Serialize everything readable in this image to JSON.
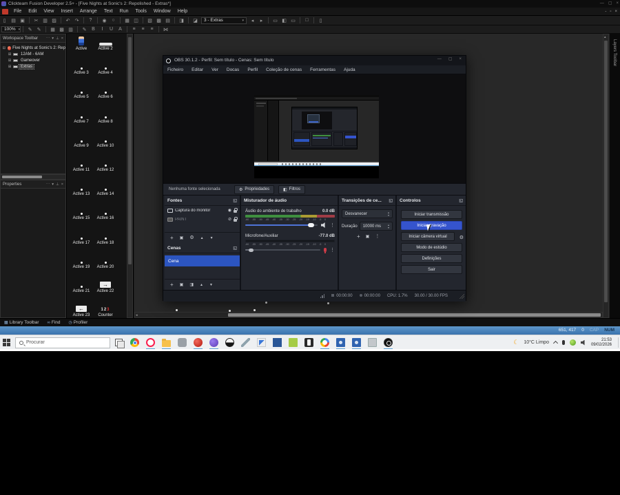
{
  "fusion": {
    "title": "Clickteam Fusion Developer 2.5+ - [Five Nights at Sonic's 2: Repolished - Extras*]",
    "window_buttons": [
      {
        "name": "minimize-button",
        "glyph": "—"
      },
      {
        "name": "maximize-button",
        "glyph": "▢"
      },
      {
        "name": "close-button",
        "glyph": "×"
      }
    ],
    "menus": [
      "File",
      "Edit",
      "View",
      "Insert",
      "Arrange",
      "Text",
      "Run",
      "Tools",
      "Window",
      "Help"
    ],
    "toolbar1a": [
      {
        "name": "new-file-icon",
        "glyph": "▯"
      },
      {
        "name": "open-file-icon",
        "glyph": "▤"
      },
      {
        "name": "save-icon",
        "glyph": "▣"
      },
      {
        "name": "sep",
        "glyph": ""
      },
      {
        "name": "cut-icon",
        "glyph": "✂"
      },
      {
        "name": "copy-icon",
        "glyph": "▥"
      },
      {
        "name": "paste-icon",
        "glyph": "▨"
      },
      {
        "name": "sep",
        "glyph": ""
      },
      {
        "name": "undo-icon",
        "glyph": "↶"
      },
      {
        "name": "redo-icon",
        "glyph": "↷"
      },
      {
        "name": "sep",
        "glyph": ""
      },
      {
        "name": "help-icon",
        "glyph": "?"
      },
      {
        "name": "sep",
        "glyph": ""
      },
      {
        "name": "run-application-icon",
        "glyph": "◉"
      },
      {
        "name": "run-frame-icon",
        "glyph": "○"
      },
      {
        "name": "sep",
        "glyph": ""
      },
      {
        "name": "storyboard-editor-icon",
        "glyph": "▦"
      },
      {
        "name": "frame-editor-icon",
        "glyph": "◫"
      },
      {
        "name": "sep",
        "glyph": ""
      },
      {
        "name": "event-editor-icon",
        "glyph": "▧"
      },
      {
        "name": "event-list-editor-icon",
        "glyph": "▩"
      },
      {
        "name": "data-elements-icon",
        "glyph": "▤"
      },
      {
        "name": "sep",
        "glyph": ""
      },
      {
        "name": "picture-editor-icon",
        "glyph": "◨"
      },
      {
        "name": "sep",
        "glyph": ""
      },
      {
        "name": "add-object-icon",
        "glyph": "◪"
      }
    ],
    "frame_combo": "3 - Extras",
    "toolbar1b": [
      {
        "name": "previous-frame-icon",
        "glyph": "◂"
      },
      {
        "name": "next-frame-icon",
        "glyph": "▸"
      },
      {
        "name": "sep",
        "glyph": ""
      },
      {
        "name": "dock-layout-icon",
        "glyph": "▭"
      },
      {
        "name": "workspace-toggle-icon",
        "glyph": "◧"
      },
      {
        "name": "properties-toggle-icon",
        "glyph": "▭"
      },
      {
        "name": "sep",
        "glyph": ""
      },
      {
        "name": "window-icon",
        "glyph": "□"
      },
      {
        "name": "sep",
        "glyph": ""
      },
      {
        "name": "library-icon",
        "glyph": "▯"
      }
    ],
    "zoom_combo": "100%",
    "toolbar2": [
      {
        "name": "sep",
        "glyph": ""
      },
      {
        "name": "pen-icon",
        "glyph": "✎"
      },
      {
        "name": "brush-icon",
        "glyph": "✎"
      },
      {
        "name": "sep",
        "glyph": ""
      },
      {
        "name": "grid-icon",
        "glyph": "▦"
      },
      {
        "name": "grid-snap-icon",
        "glyph": "▩"
      },
      {
        "name": "grid-setup-icon",
        "glyph": "▥"
      },
      {
        "name": "sep",
        "glyph": ""
      },
      {
        "name": "spellcheck-icon",
        "glyph": "✎"
      },
      {
        "name": "bold-icon",
        "glyph": "B"
      },
      {
        "name": "italic-icon",
        "glyph": "I"
      },
      {
        "name": "underline-icon",
        "glyph": "U"
      },
      {
        "name": "font-color-icon",
        "glyph": "A"
      },
      {
        "name": "sep",
        "glyph": ""
      },
      {
        "name": "align-left-icon",
        "glyph": "≡"
      },
      {
        "name": "align-center-icon",
        "glyph": "≡"
      },
      {
        "name": "align-right-icon",
        "glyph": "≡"
      },
      {
        "name": "sep",
        "glyph": ""
      },
      {
        "name": "transform-icon",
        "glyph": "⋈"
      }
    ],
    "mdi_buttons": [
      {
        "name": "mdi-minimize-button",
        "glyph": "-"
      },
      {
        "name": "mdi-restore-button",
        "glyph": "▫"
      },
      {
        "name": "mdi-close-button",
        "glyph": "×"
      }
    ],
    "bottom_tabs": [
      {
        "label": "Library Toolbar",
        "icon": "▦",
        "name": "tab-library-toolbar"
      },
      {
        "label": "Find",
        "icon": "∞",
        "name": "tab-find"
      },
      {
        "label": "Profiler",
        "icon": "◷",
        "name": "tab-profiler"
      }
    ],
    "status": {
      "coords": "651, 417",
      "count": "0",
      "cap": "CAP",
      "num": "NUM"
    }
  },
  "workspace": {
    "title": "Workspace Toolbar",
    "header_buttons": [
      {
        "name": "dock-dots-icon",
        "glyph": "⋯"
      },
      {
        "name": "collapse-icon",
        "glyph": "▾"
      },
      {
        "name": "pin-icon",
        "glyph": "⊥"
      },
      {
        "name": "close-icon",
        "glyph": "×"
      }
    ],
    "root": "Five Nights at Sonic's 2: Rep",
    "children": [
      "12AM - 6AM",
      "Gameover",
      "Extras"
    ],
    "selected": "Extras"
  },
  "properties": {
    "title": "Properties"
  },
  "objects": {
    "counter_white": "12",
    "counter_red": "3",
    "items": [
      {
        "label": "Active",
        "kind": "sprite"
      },
      {
        "label": "Active 2",
        "kind": "bar"
      },
      {
        "label": "Active 3",
        "kind": "dot"
      },
      {
        "label": "Active 4",
        "kind": "dot"
      },
      {
        "label": "Active 5",
        "kind": "dot"
      },
      {
        "label": "Active 6",
        "kind": "dot"
      },
      {
        "label": "Active 7",
        "kind": "dot"
      },
      {
        "label": "Active 8",
        "kind": "dot"
      },
      {
        "label": "Active 9",
        "kind": "dot"
      },
      {
        "label": "Active 10",
        "kind": "dot"
      },
      {
        "label": "Active 11",
        "kind": "dot"
      },
      {
        "label": "Active 12",
        "kind": "dot"
      },
      {
        "label": "Active 13",
        "kind": "dot"
      },
      {
        "label": "Active 14",
        "kind": "dot"
      },
      {
        "label": "Active 15",
        "kind": "dot"
      },
      {
        "label": "Active 16",
        "kind": "dot"
      },
      {
        "label": "Active 17",
        "kind": "dot"
      },
      {
        "label": "Active 18",
        "kind": "dot"
      },
      {
        "label": "Active 19",
        "kind": "dot"
      },
      {
        "label": "Active 20",
        "kind": "dot"
      },
      {
        "label": "Active 21",
        "kind": "dot"
      },
      {
        "label": "Active 22",
        "kind": "arrow",
        "glyph": "→"
      },
      {
        "label": "Active 23",
        "kind": "arrow",
        "glyph": "←"
      },
      {
        "label": "Counter",
        "kind": "counter"
      }
    ]
  },
  "frame_dots": [
    [
      255,
      449
    ],
    [
      332,
      450
    ],
    [
      368,
      449
    ],
    [
      385,
      438
    ],
    [
      475,
      439
    ]
  ],
  "layers": {
    "title": "Layers Toolbar"
  },
  "obs": {
    "title": "OBS 30.1.2 - Perfil: Sem título - Cenas: Sem título",
    "window_buttons": [
      {
        "name": "minimize-button",
        "glyph": "—"
      },
      {
        "name": "maximize-button",
        "glyph": "▢"
      },
      {
        "name": "close-button",
        "glyph": "×"
      }
    ],
    "menus": [
      "Ficheiro",
      "Editar",
      "Ver",
      "Docas",
      "Perfil",
      "Coleção de cenas",
      "Ferramentas",
      "Ajuda"
    ],
    "no_source": "Nenhuma fonte selecionada",
    "properties_btn": "Propriedades",
    "filters_btn": "Filtros",
    "fontes": {
      "title": "Fontes",
      "items": [
        {
          "label": "Captura do monitor",
          "visible": true,
          "eye": "◉"
        },
        {
          "label": "PAINT",
          "visible": false,
          "eye": "⊘"
        }
      ]
    },
    "cenas": {
      "title": "Cenas",
      "item": "Cena"
    },
    "mixer": {
      "title": "Misturador de áudio",
      "tracks": [
        {
          "name": "Áudio do ambiente de trabalho",
          "db": "0.0 dB"
        },
        {
          "name": "Microfone/Auxiliar",
          "db": "-77.0 dB"
        }
      ],
      "scale": [
        "-60",
        "-55",
        "-50",
        "-45",
        "-40",
        "-35",
        "-30",
        "-25",
        "-20",
        "-15",
        "-10",
        "-5",
        "0"
      ]
    },
    "transitions": {
      "title": "Transições de ce...",
      "selected": "Desvanecer",
      "duration_label": "Duração",
      "duration_value": "10000 ms"
    },
    "controls": {
      "title": "Controlos",
      "buttons": [
        {
          "label": "Iniciar transmissão",
          "active": false,
          "name": "start-streaming-button"
        },
        {
          "label": "Iniciar gravação",
          "active": true,
          "name": "start-recording-button"
        },
        {
          "label": "Iniciar câmera virtual",
          "active": false,
          "name": "start-virtual-camera-button",
          "gear": true
        },
        {
          "label": "Modo de estúdio",
          "active": false,
          "name": "studio-mode-button"
        },
        {
          "label": "Definições",
          "active": false,
          "name": "settings-button"
        },
        {
          "label": "Sair",
          "active": false,
          "name": "exit-button"
        }
      ]
    },
    "status": {
      "stream_time": "00:00:00",
      "rec_time": "00:00:00",
      "cpu": "CPU: 1.7%",
      "fps": "30.00 / 30.00 FPS"
    }
  },
  "taskbar": {
    "search_placeholder": "Procurar",
    "apps": [
      {
        "name": "chrome-icon",
        "kind": "chrome",
        "active": false
      },
      {
        "name": "opera-gx-icon",
        "kind": "opera",
        "active": true
      },
      {
        "name": "file-explorer-icon",
        "kind": "folder",
        "active": true
      },
      {
        "name": "gray-app-icon",
        "kind": "gray",
        "active": false
      },
      {
        "name": "red-app-icon",
        "kind": "red",
        "active": true
      },
      {
        "name": "purple-app-icon",
        "kind": "purple",
        "active": true
      },
      {
        "name": "ball-app-icon",
        "kind": "ball",
        "active": false
      },
      {
        "name": "brush-app-icon",
        "kind": "brush",
        "active": false
      },
      {
        "name": "editor-app-icon",
        "kind": "editor",
        "active": false
      },
      {
        "name": "blue-app-icon",
        "kind": "blue",
        "active": false
      },
      {
        "name": "green-app-icon",
        "kind": "green",
        "active": false
      },
      {
        "name": "epic-games-icon",
        "kind": "epic",
        "active": false
      },
      {
        "name": "g-app-icon",
        "kind": "g",
        "active": true
      },
      {
        "name": "fusion-window-icon",
        "kind": "fusion",
        "active": true
      },
      {
        "name": "fusion-window-2-icon",
        "kind": "fusion",
        "active": true
      },
      {
        "name": "gray-window-icon",
        "kind": "gray2",
        "active": false
      },
      {
        "name": "obs-icon",
        "kind": "obs",
        "active": true
      }
    ],
    "tray": {
      "temp": "10°C Limpo",
      "time": "21:53",
      "date": "09/02/2026"
    }
  },
  "colors": {
    "accent_blue": "#3554cd",
    "scene_blue": "#2c55c0",
    "status_blue": "#3a72ad",
    "meter_green": "#3f8f3f",
    "meter_yellow": "#ab9b33",
    "meter_red": "#a03c46"
  }
}
